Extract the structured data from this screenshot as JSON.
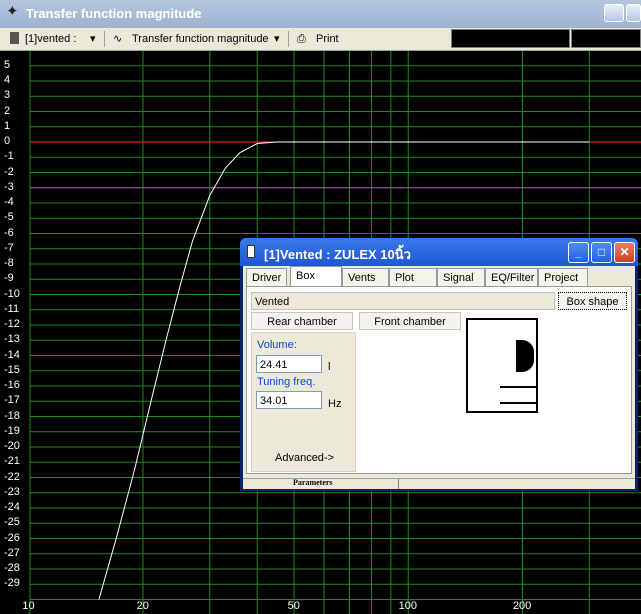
{
  "window": {
    "title": "Transfer function magnitude",
    "icon": "crosshair-icon"
  },
  "toolbar": {
    "project_select": "[1]vented :",
    "plot_select": "Transfer function magnitude",
    "print_label": "Print"
  },
  "chart_data": {
    "type": "line",
    "xscale": "log",
    "xlim": [
      8,
      330
    ],
    "ylim": [
      -30,
      5.5
    ],
    "xticks": [
      "10",
      "20",
      "50",
      "100",
      "200"
    ],
    "yticks": [
      "5",
      "4",
      "3",
      "2",
      "1",
      "0",
      "-1",
      "-2",
      "-3",
      "-4",
      "-5",
      "-6",
      "-7",
      "-8",
      "-9",
      "-10",
      "-11",
      "-12",
      "-13",
      "-14",
      "-15",
      "-16",
      "-17",
      "-18",
      "-19",
      "-20",
      "-21",
      "-22",
      "-23",
      "-24",
      "-25",
      "-26",
      "-27",
      "-28",
      "-29"
    ],
    "grid": true,
    "reference_lines": [
      {
        "y": 0,
        "color": "#ff2a2a"
      },
      {
        "y": -3,
        "color": "#c03cc0"
      }
    ],
    "series": [
      {
        "color": "#ffffff",
        "x": [
          15.3,
          17,
          19,
          21,
          23,
          25,
          27,
          30,
          33,
          36,
          40,
          45,
          50,
          60,
          70,
          100,
          200,
          300
        ],
        "y": [
          -30,
          -26,
          -21.5,
          -17,
          -13,
          -9.5,
          -6.5,
          -3.5,
          -1.7,
          -0.7,
          -0.1,
          0,
          0,
          0,
          0,
          0,
          0,
          0
        ]
      }
    ],
    "colors": {
      "background": "#000000",
      "grid": "#1e8c1e",
      "curve": "#ffffff"
    }
  },
  "dialog": {
    "title": "[1]Vented : ZULEX 10นิ้ว",
    "tabs": [
      "Driver",
      "Box",
      "Vents",
      "Plot",
      "Signal",
      "EQ/Filter",
      "Project"
    ],
    "active_tab": "Box",
    "box_type": "Vented",
    "box_shape_button": "Box shape",
    "rear_chamber_button": "Rear chamber",
    "front_chamber_button": "Front chamber",
    "volume_label": "Volume:",
    "volume_value": "24.41",
    "volume_unit": "l",
    "tuning_label": "Tuning freq.",
    "tuning_value": "34.01",
    "tuning_unit": "Hz",
    "advanced_button": "Advanced->",
    "status_panel": "Parameters"
  }
}
